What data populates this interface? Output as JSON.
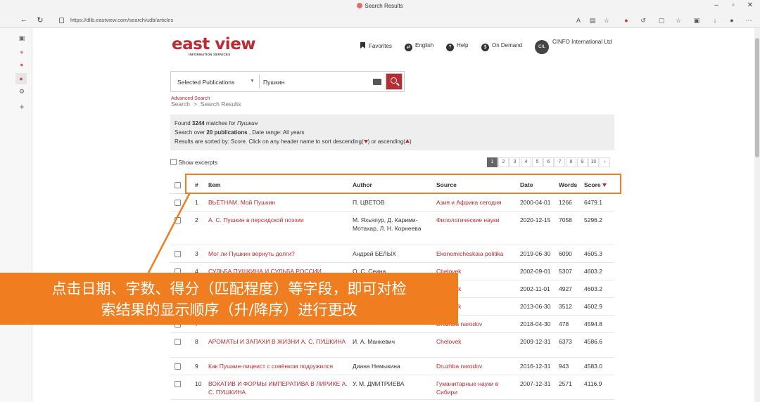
{
  "browser": {
    "tab_title": "Search Results",
    "url": "https://dlib.eastview.com/search/udb/articles"
  },
  "site": {
    "logo_main": "east view",
    "logo_sub": "INFORMATION SERVICES",
    "links": {
      "favorites": "Favorites",
      "language": "English",
      "help": "Help",
      "on_demand": "On Demand",
      "account_initials": "CIL",
      "account": "CINFO International Ltd"
    }
  },
  "search": {
    "scope": "Selected Publications",
    "query": "Пушкин",
    "advanced": "Advanced Search",
    "breadcrumb_home": "Search",
    "breadcrumb_sep": ">",
    "breadcrumb_current": "Search Results"
  },
  "info": {
    "found_pre": "Found ",
    "found_count": "3244",
    "found_mid": " matches for ",
    "found_query": "Пушкин",
    "over_pre": "Search over ",
    "over_count": "20 publications",
    "over_post": " , Date range: All years",
    "sorted_pre": "Results are sorted by: Score. Click on any header name to sort descending(",
    "sorted_mid": ") or ascending(",
    "sorted_post": ")"
  },
  "controls": {
    "show_excerpts": "Show excerpts",
    "pages": [
      "1",
      "2",
      "3",
      "4",
      "5",
      "6",
      "7",
      "8",
      "9",
      "10",
      "›"
    ]
  },
  "table": {
    "headers": {
      "num": "#",
      "item": "Item",
      "author": "Author",
      "source": "Source",
      "date": "Date",
      "words": "Words",
      "score": "Score"
    },
    "rows": [
      {
        "num": "1",
        "item": "ВЬЕТНАМ. Мой Пушкин",
        "author": "П. ЦВЕТОВ",
        "source": "Азия и Африка сегодня",
        "date": "2000-04-01",
        "words": "1266",
        "score": "6479.1"
      },
      {
        "num": "2",
        "item": "А. С. Пушкин в персидской поэзии",
        "author": "М. Яхьяпур, Д. Карими-Мотахар, Л. Н. Корнеева",
        "source": "Филологические науки",
        "date": "2020-12-15",
        "words": "7058",
        "score": "5296.2"
      },
      {
        "num": "3",
        "item": "Мог ли Пушкин вернуть долги?",
        "author": "Андрей БЕЛЫХ",
        "source": "Ekonomicheskaia politika",
        "date": "2019-06-30",
        "words": "6090",
        "score": "4605.3"
      },
      {
        "num": "4",
        "item": "СУДЬБА ПУШКИНА И СУДЬБА РОССИИ",
        "author": "О. С. Сеина",
        "source": "Chelovek",
        "date": "2002-09-01",
        "words": "5307",
        "score": "4603.2"
      },
      {
        "num": "5",
        "item": "",
        "author": "",
        "source": "Chelovek",
        "date": "2002-11-01",
        "words": "4927",
        "score": "4603.2"
      },
      {
        "num": "6",
        "item": "",
        "author": "",
        "source": "Chelovek",
        "date": "2013-06-30",
        "words": "3512",
        "score": "4602.9"
      },
      {
        "num": "7",
        "item": "",
        "author": "",
        "source": "Druzhba narodov",
        "date": "2018-04-30",
        "words": "478",
        "score": "4594.8"
      },
      {
        "num": "8",
        "item": "АРОМАТЫ И ЗАПАХИ В ЖИЗНИ А. С. ПУШКИНА",
        "author": "И. А. Манкевич",
        "source": "Chelovek",
        "date": "2009-12-31",
        "words": "6373",
        "score": "4586.6"
      },
      {
        "num": "9",
        "item": "Как Пушкин-лицеист с совёнком подружился",
        "author": "Диана Немыкина",
        "source": "Druzhba narodov",
        "date": "2016-12-31",
        "words": "943",
        "score": "4583.0"
      },
      {
        "num": "10",
        "item": "ВОКАТИВ И ФОРМЫ ИМПЕРАТИВА В ЛИРИКЕ А. С. ПУШКИНА",
        "author": "У. М. ДМИТРИЕВА",
        "source": "Гуманитарные науки в Сибири",
        "date": "2007-12-31",
        "words": "2571",
        "score": "4116.9"
      }
    ]
  },
  "annotation": {
    "line1": "点击日期、字数、得分（匹配程度）等字段，即可对检",
    "line2": "索结果的显示顺序（升/降序）进行更改",
    "color": "#f07d1f"
  }
}
